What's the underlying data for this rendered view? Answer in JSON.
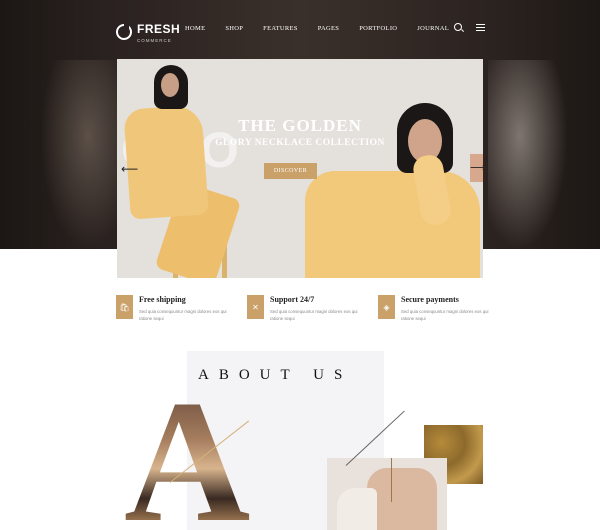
{
  "brand": {
    "name": "FRESH",
    "tagline": "COMMERCE"
  },
  "nav": {
    "items": [
      "HOME",
      "SHOP",
      "FEATURES",
      "PAGES",
      "PORTFOLIO",
      "JOURNAL"
    ]
  },
  "hero": {
    "background_word": "ODO",
    "title": "THE GOLDEN",
    "subtitle": "GLORY NECKLACE COLLECTION",
    "button": "DISCOVER",
    "prev_icon": "arrow-left-icon",
    "next_icon": "arrow-right-icon"
  },
  "features": [
    {
      "title": "Free shipping",
      "desc": "Sed quia consequuntur magni dolores eos qui ratione sequi",
      "icon": "bag-icon"
    },
    {
      "title": "Support 24/7",
      "desc": "Sed quia consequuntur magni dolores eos qui ratione sequi",
      "icon": "support-icon"
    },
    {
      "title": "Secure payments",
      "desc": "Sed quia consequuntur magni dolores eos qui ratione sequi",
      "icon": "card-icon"
    }
  ],
  "about": {
    "title": "ABOUT US",
    "letter": "A"
  },
  "colors": {
    "accent": "#c9a169",
    "dark": "#2a2220",
    "panel": "#f4f3f5"
  }
}
